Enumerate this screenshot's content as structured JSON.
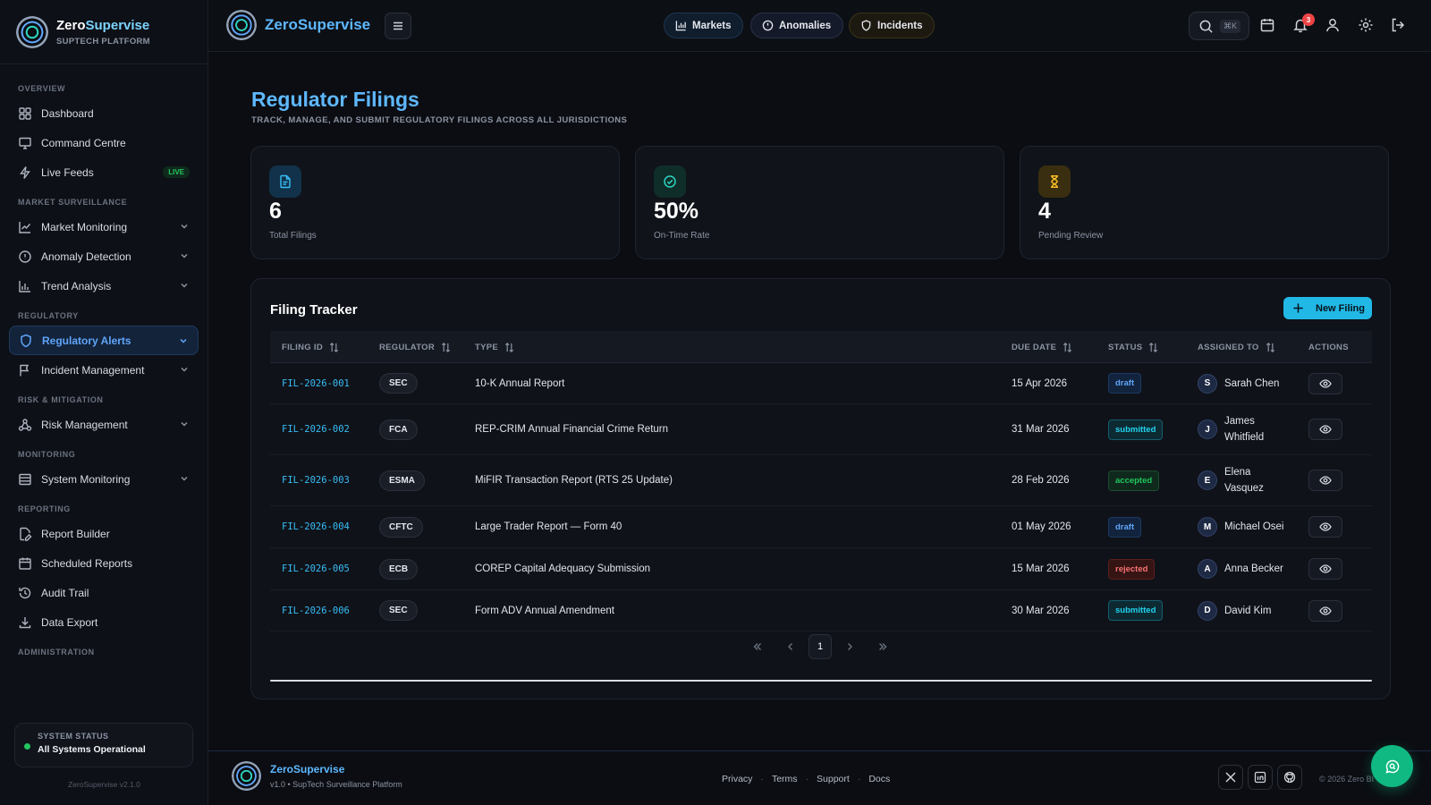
{
  "colors": {
    "accent": "#5eb8ff",
    "cyan": "#22b8e6",
    "success": "#22c55e",
    "danger": "#ef4444",
    "background": "#0b0d12"
  },
  "sidebar": {
    "brand_name_a": "Zero",
    "brand_name_b": "Supervise",
    "brand_sub": "SUPTECH PLATFORM",
    "sections": {
      "overview": "OVERVIEW",
      "market": "MARKET SURVEILLANCE",
      "regulatory": "REGULATORY",
      "risk": "RISK & MITIGATION",
      "monitoring": "MONITORING",
      "reporting": "REPORTING",
      "admin": "ADMINISTRATION"
    },
    "items": {
      "dashboard": "Dashboard",
      "command_centre": "Command Centre",
      "live_feeds": "Live Feeds",
      "live_badge": "LIVE",
      "market_monitoring": "Market Monitoring",
      "anomaly_detection": "Anomaly Detection",
      "trend_analysis": "Trend Analysis",
      "regulatory_alerts": "Regulatory Alerts",
      "incident_management": "Incident Management",
      "risk_management": "Risk Management",
      "system_monitoring": "System Monitoring",
      "report_builder": "Report Builder",
      "scheduled_reports": "Scheduled Reports",
      "audit_trail": "Audit Trail",
      "data_export": "Data Export"
    },
    "status_label": "SYSTEM STATUS",
    "status_value": "All Systems Operational",
    "version": "ZeroSupervise v2.1.0"
  },
  "topbar": {
    "title": "ZeroSupervise",
    "pills": {
      "markets": "Markets",
      "anomalies": "Anomalies",
      "incidents": "Incidents"
    },
    "search_shortcut": "⌘K",
    "notification_count": "3"
  },
  "page": {
    "title": "Regulator Filings",
    "subtitle": "TRACK, MANAGE, AND SUBMIT REGULATORY FILINGS ACROSS ALL JURISDICTIONS"
  },
  "stats": [
    {
      "value": "6",
      "label": "Total Filings",
      "icon": "file-icon"
    },
    {
      "value": "50%",
      "label": "On-Time Rate",
      "icon": "check-circle-icon"
    },
    {
      "value": "4",
      "label": "Pending Review",
      "icon": "hourglass-icon"
    }
  ],
  "tracker": {
    "title": "Filing Tracker",
    "new_button": "New Filing",
    "columns": {
      "filing_id": "FILING ID",
      "regulator": "REGULATOR",
      "type": "TYPE",
      "due_date": "DUE DATE",
      "status": "STATUS",
      "assigned_to": "ASSIGNED TO",
      "actions": "ACTIONS"
    },
    "rows": [
      {
        "id": "FIL-2026-001",
        "regulator": "SEC",
        "type": "10-K Annual Report",
        "due": "15 Apr 2026",
        "status": "draft",
        "initial": "S",
        "assignee": "Sarah Chen"
      },
      {
        "id": "FIL-2026-002",
        "regulator": "FCA",
        "type": "REP-CRIM Annual Financial Crime Return",
        "due": "31 Mar 2026",
        "status": "submitted",
        "initial": "J",
        "assignee": "James Whitfield"
      },
      {
        "id": "FIL-2026-003",
        "regulator": "ESMA",
        "type": "MiFIR Transaction Report (RTS 25 Update)",
        "due": "28 Feb 2026",
        "status": "accepted",
        "initial": "E",
        "assignee": "Elena Vasquez"
      },
      {
        "id": "FIL-2026-004",
        "regulator": "CFTC",
        "type": "Large Trader Report — Form 40",
        "due": "01 May 2026",
        "status": "draft",
        "initial": "M",
        "assignee": "Michael Osei"
      },
      {
        "id": "FIL-2026-005",
        "regulator": "ECB",
        "type": "COREP Capital Adequacy Submission",
        "due": "15 Mar 2026",
        "status": "rejected",
        "initial": "A",
        "assignee": "Anna Becker"
      },
      {
        "id": "FIL-2026-006",
        "regulator": "SEC",
        "type": "Form ADV Annual Amendment",
        "due": "30 Mar 2026",
        "status": "submitted",
        "initial": "D",
        "assignee": "David Kim"
      }
    ],
    "current_page": "1"
  },
  "footer": {
    "name": "ZeroSupervise",
    "tagline": "v1.0 • SupTech Surveillance Platform",
    "links": {
      "privacy": "Privacy",
      "terms": "Terms",
      "support": "Support",
      "docs": "Docs"
    },
    "copyright": "© 2026 Zero BI"
  }
}
